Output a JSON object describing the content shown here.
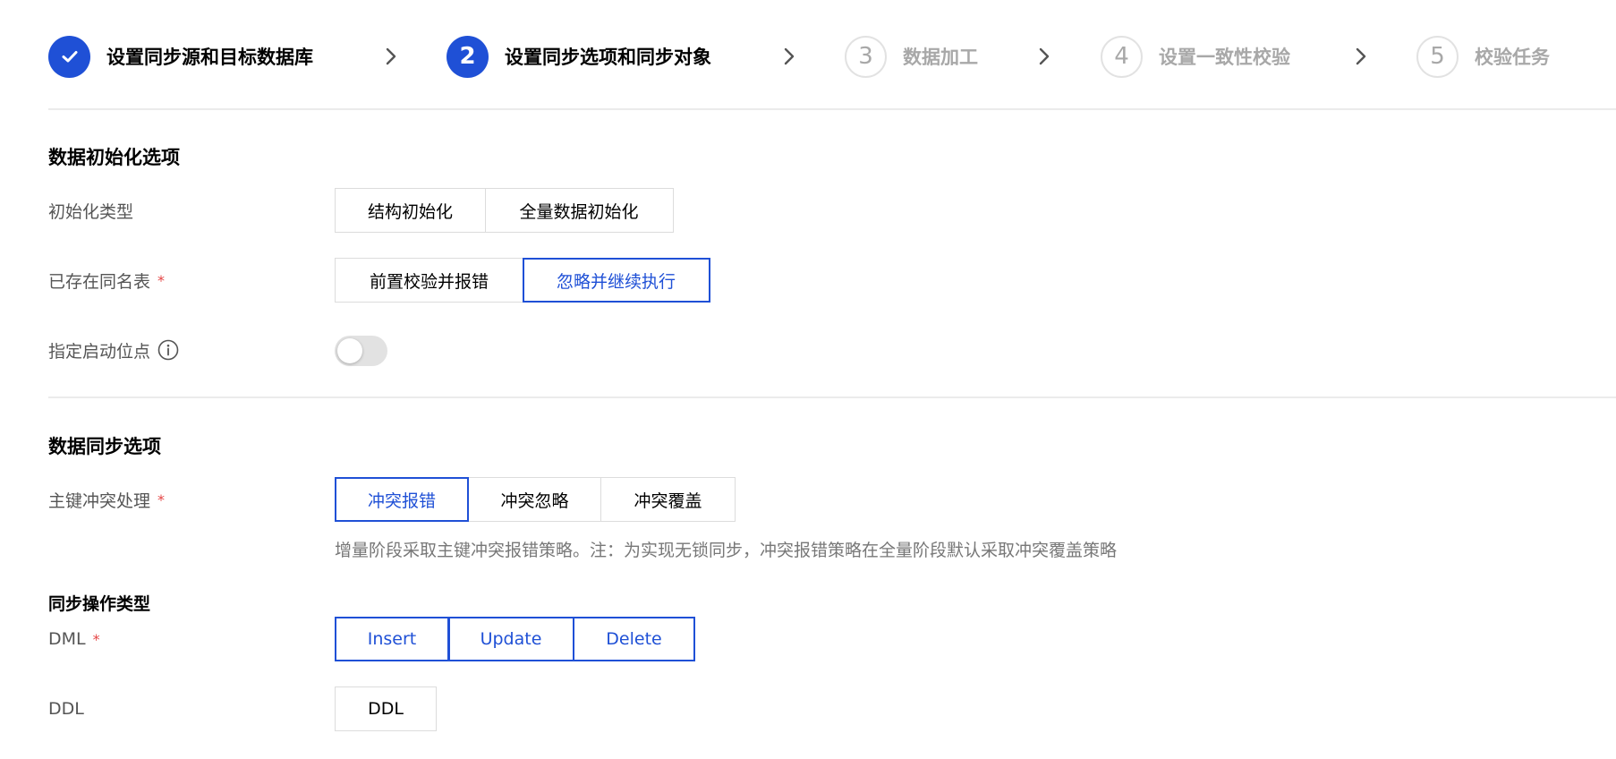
{
  "steps": [
    {
      "number": "",
      "label": "设置同步源和目标数据库",
      "state": "done"
    },
    {
      "number": "2",
      "label": "设置同步选项和同步对象",
      "state": "active"
    },
    {
      "number": "3",
      "label": "数据加工",
      "state": "todo"
    },
    {
      "number": "4",
      "label": "设置一致性校验",
      "state": "todo"
    },
    {
      "number": "5",
      "label": "校验任务",
      "state": "todo"
    }
  ],
  "init_section": {
    "title": "数据初始化选项",
    "init_type": {
      "label": "初始化类型",
      "options": [
        "结构初始化",
        "全量数据初始化"
      ]
    },
    "existing_table": {
      "label": "已存在同名表",
      "required_mark": "*",
      "options": [
        "前置校验并报错",
        "忽略并继续执行"
      ],
      "selected": "忽略并继续执行"
    },
    "start_position": {
      "label": "指定启动位点",
      "enabled": false
    }
  },
  "sync_section": {
    "title": "数据同步选项",
    "pk_conflict": {
      "label": "主键冲突处理",
      "required_mark": "*",
      "options": [
        "冲突报错",
        "冲突忽略",
        "冲突覆盖"
      ],
      "selected": "冲突报错",
      "hint": "增量阶段采取主键冲突报错策略。注：为实现无锁同步，冲突报错策略在全量阶段默认采取冲突覆盖策略"
    },
    "op_types_title": "同步操作类型",
    "dml": {
      "label": "DML",
      "required_mark": "*",
      "options": [
        "Insert",
        "Update",
        "Delete"
      ],
      "selected": [
        "Insert",
        "Update",
        "Delete"
      ]
    },
    "ddl": {
      "label": "DDL",
      "options": [
        "DDL"
      ]
    }
  },
  "colors": {
    "accent": "#1f50d6",
    "required": "#e54545",
    "label_gray": "#555555",
    "disabled_gray": "#a8a8a8"
  }
}
